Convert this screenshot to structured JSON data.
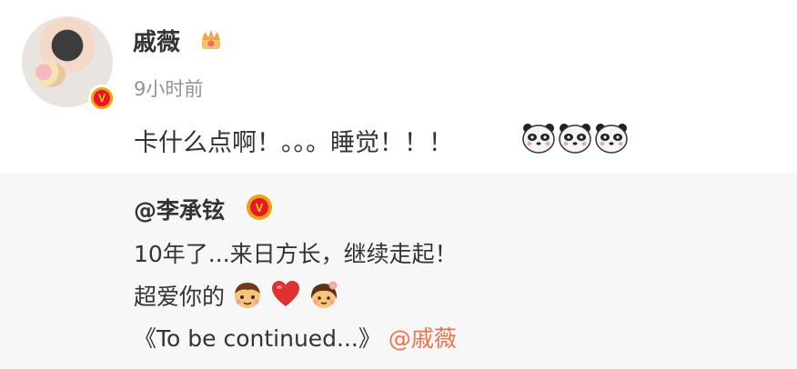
{
  "post": {
    "username": "戚薇",
    "time": "9小时前",
    "text": "卡什么点啊！。。。睡觉！！！",
    "verified_mark": "V",
    "icons": [
      "crown-icon",
      "panda-emoji",
      "panda-emoji",
      "panda-emoji"
    ]
  },
  "repost": {
    "author": "@李承铉",
    "verified_mark": "V",
    "line1": "10年了...来日方长，继续走起！",
    "line2_text": "超爱你的",
    "line2_emojis": [
      "boy-emoji",
      "heart-emoji",
      "girl-emoji"
    ],
    "line3_text": "《To be continued...》",
    "line3_mention": "@戚薇"
  },
  "colors": {
    "mention": "#eb7350",
    "time": "#939393",
    "repost_bg": "#f7f7f7",
    "badge_red": "#e6162d",
    "badge_gold": "#f0a010"
  }
}
